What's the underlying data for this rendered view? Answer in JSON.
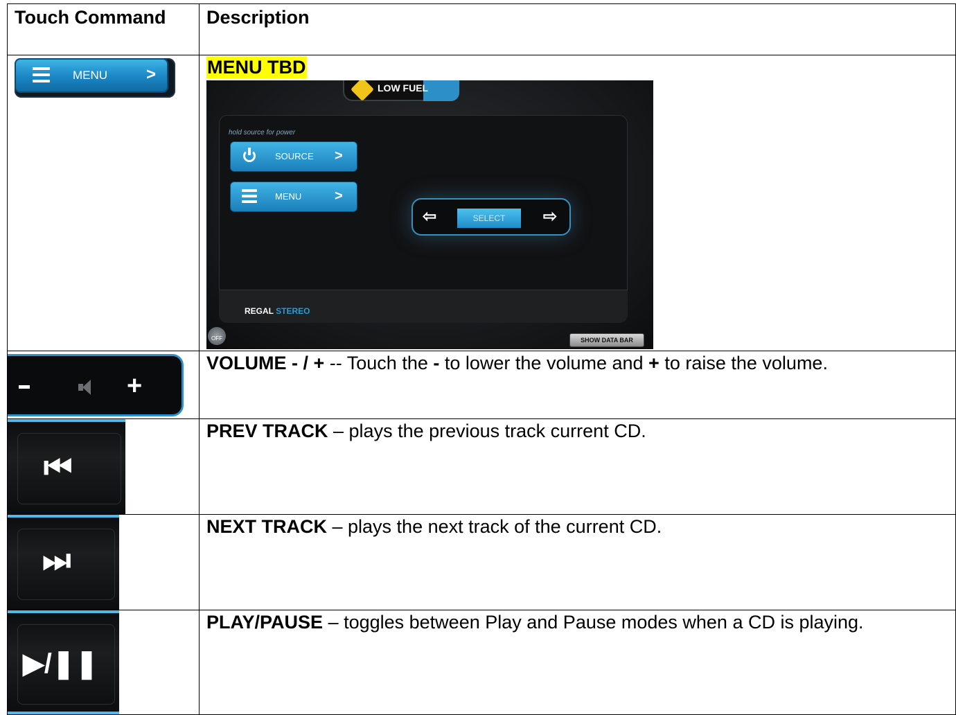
{
  "table": {
    "headers": {
      "command": "Touch Command",
      "description": "Description"
    },
    "rows": {
      "menu": {
        "button": {
          "label": "MENU",
          "chevron": ">",
          "icon": "hamburger-icon"
        },
        "title": "MENU TBD",
        "screenshot": {
          "alert": "LOW FUEL",
          "hint": "hold source for power",
          "source_label": "SOURCE",
          "menu_label": "MENU",
          "chevron": ">",
          "select_label": "SELECT",
          "left_arrow": "⇦",
          "right_arrow": "⇨",
          "brand_a": "REGAL",
          "brand_b": "STEREO",
          "off_label": "OFF",
          "data_bar_label": "SHOW DATA BAR"
        }
      },
      "volume": {
        "minus": "-",
        "plus": "+",
        "title": "VOLUME - / +",
        "t1": " -- Touch the ",
        "b1": "-",
        "t2": " to lower the volume and ",
        "b2": "+",
        "t3": " to raise the volume."
      },
      "prev": {
        "icon_glyph": "⏮",
        "title": "PREV TRACK",
        "text": " – plays the previous track current CD."
      },
      "next": {
        "icon_glyph": "⏭",
        "title": "NEXT TRACK",
        "text": " – plays the next track of the current CD."
      },
      "play": {
        "icon_glyph": "▶/❚❚",
        "title": "PLAY/PAUSE",
        "text": " – toggles between Play and Pause modes when a CD is playing."
      }
    }
  },
  "colors": {
    "accent_blue": "#2c8fc7",
    "highlight": "#ffff00",
    "alert_yellow": "#f0c419"
  }
}
